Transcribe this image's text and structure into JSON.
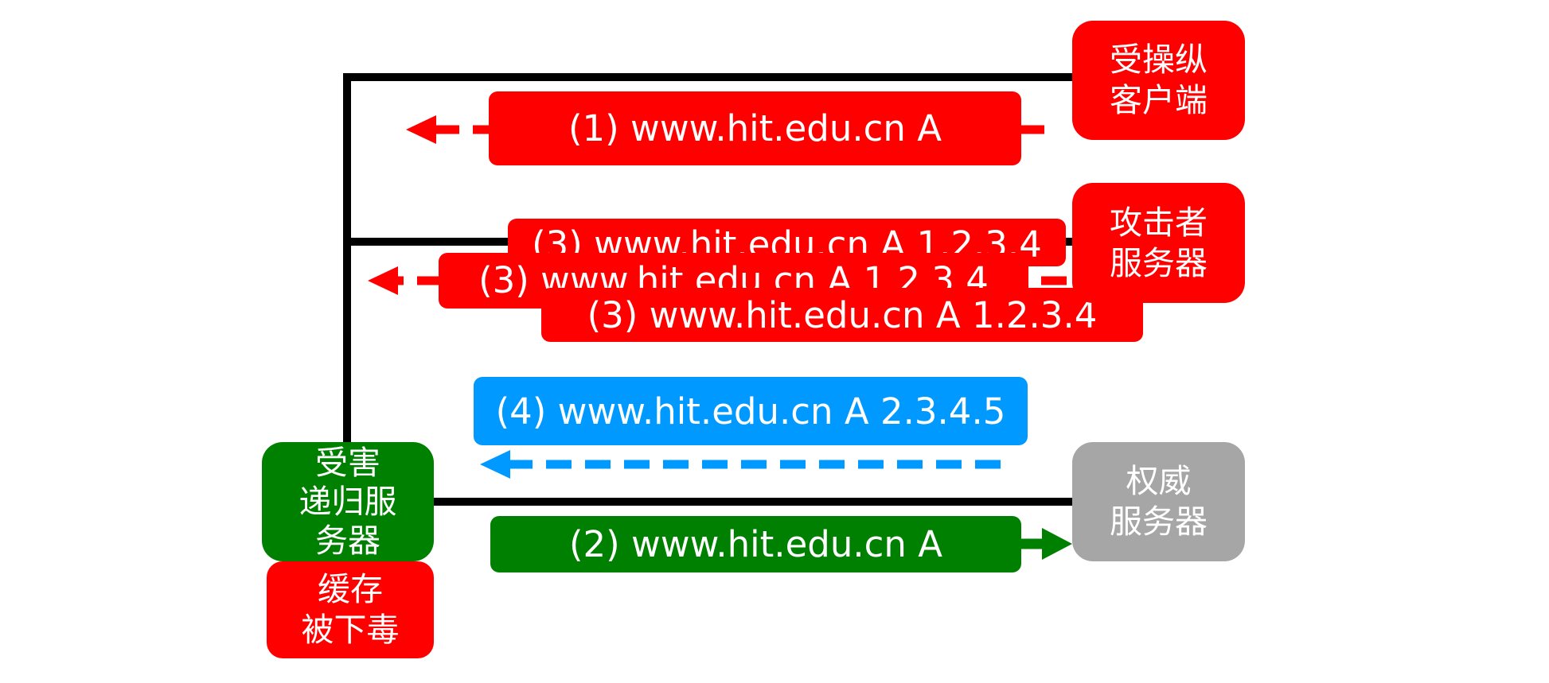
{
  "nodes": {
    "client": {
      "line1": "受操纵",
      "line2": "客户端",
      "color": "#ff0000"
    },
    "attacker": {
      "line1": "攻击者",
      "line2": "服务器",
      "color": "#ff0000"
    },
    "authoritative": {
      "line1": "权威",
      "line2": "服务器",
      "color": "#a6a6a6"
    },
    "resolver": {
      "line1": "受害",
      "line2": "递归服",
      "line3": "务器",
      "color": "#008000"
    },
    "poisoned": {
      "line1": "缓存",
      "line2": "被下毒",
      "color": "#ff0000"
    }
  },
  "messages": {
    "m1": {
      "text": "(1) www.hit.edu.cn A",
      "color": "#ff0000"
    },
    "m2": {
      "text": "(2) www.hit.edu.cn A",
      "color": "#008000"
    },
    "m3a": {
      "text": "(3) www.hit.edu.cn A 1.2.3.4",
      "color": "#ff0000"
    },
    "m3b": {
      "text": "(3) www.hit.edu.cn A 1.2.3.4",
      "color": "#ff0000"
    },
    "m3c": {
      "text": "(3) www.hit.edu.cn A 1.2.3.4",
      "color": "#ff0000"
    },
    "m4": {
      "text": "(4) www.hit.edu.cn A 2.3.4.5",
      "color": "#0099ff"
    }
  },
  "colors": {
    "line": "#000000",
    "red": "#ff0000",
    "green": "#008000",
    "blue": "#0099ff",
    "gray": "#a6a6a6"
  }
}
